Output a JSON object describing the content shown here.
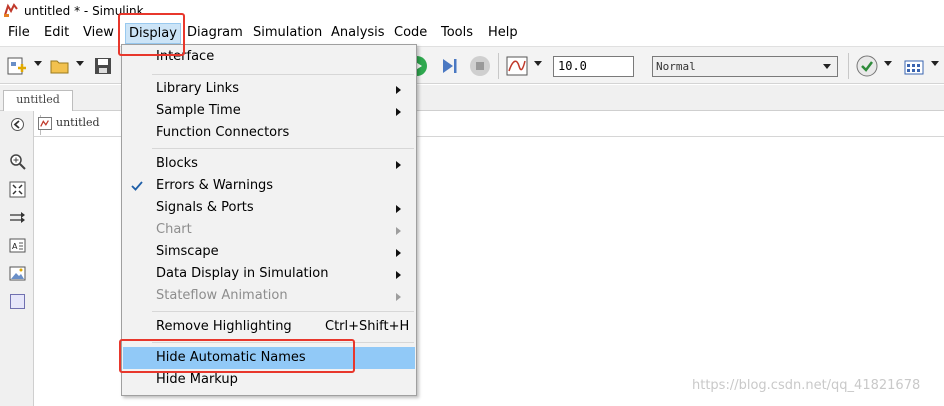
{
  "window": {
    "title": "untitled * - Simulink"
  },
  "menubar": {
    "items": [
      {
        "label": "File"
      },
      {
        "label": "Edit"
      },
      {
        "label": "View"
      },
      {
        "label": "Display"
      },
      {
        "label": "Diagram"
      },
      {
        "label": "Simulation"
      },
      {
        "label": "Analysis"
      },
      {
        "label": "Code"
      },
      {
        "label": "Tools"
      },
      {
        "label": "Help"
      }
    ]
  },
  "toolbar": {
    "stop_time": "10.0",
    "simulation_mode": "Normal",
    "icons": [
      "new-model-icon",
      "open-icon",
      "save-icon",
      "run-icon",
      "step-forward-icon",
      "stop-icon",
      "scope-icon",
      "model-advisor-icon",
      "library-browser-icon"
    ]
  },
  "tabs": [
    {
      "label": "untitled"
    }
  ],
  "address": {
    "path": "untitled"
  },
  "display_menu": {
    "items": [
      {
        "label": "Interface",
        "submenu": false,
        "enabled": true,
        "checked": false,
        "highlighted": false
      },
      {
        "label": "Library Links",
        "submenu": true,
        "enabled": true,
        "checked": false,
        "highlighted": false
      },
      {
        "label": "Sample Time",
        "submenu": true,
        "enabled": true,
        "checked": false,
        "highlighted": false
      },
      {
        "label": "Function Connectors",
        "submenu": false,
        "enabled": true,
        "checked": false,
        "highlighted": false
      },
      {
        "label": "Blocks",
        "submenu": true,
        "enabled": true,
        "checked": false,
        "highlighted": false
      },
      {
        "label": "Errors & Warnings",
        "submenu": false,
        "enabled": true,
        "checked": true,
        "highlighted": false
      },
      {
        "label": "Signals & Ports",
        "submenu": true,
        "enabled": true,
        "checked": false,
        "highlighted": false
      },
      {
        "label": "Chart",
        "submenu": true,
        "enabled": false,
        "checked": false,
        "highlighted": false
      },
      {
        "label": "Simscape",
        "submenu": true,
        "enabled": true,
        "checked": false,
        "highlighted": false
      },
      {
        "label": "Data Display in Simulation",
        "submenu": true,
        "enabled": true,
        "checked": false,
        "highlighted": false
      },
      {
        "label": "Stateflow Animation",
        "submenu": true,
        "enabled": false,
        "checked": false,
        "highlighted": false
      },
      {
        "label": "Remove Highlighting",
        "shortcut": "Ctrl+Shift+H",
        "submenu": false,
        "enabled": true,
        "checked": false,
        "highlighted": false
      },
      {
        "label": "Hide Automatic Names",
        "submenu": false,
        "enabled": true,
        "checked": false,
        "highlighted": true
      },
      {
        "label": "Hide Markup",
        "submenu": false,
        "enabled": true,
        "checked": false,
        "highlighted": false
      }
    ]
  },
  "left_toolbar": {
    "icons": [
      "hide-explorer-icon",
      "zoom-in-icon",
      "fit-to-view-icon",
      "signal-arrow-icon",
      "annotation-icon",
      "image-icon",
      "area-icon"
    ]
  },
  "watermark": "https://blog.csdn.net/qq_41821678",
  "colors": {
    "menu_highlight": "#91c9f7",
    "annotation_red": "#e8372c",
    "menubar_open": "#cce4f7"
  }
}
